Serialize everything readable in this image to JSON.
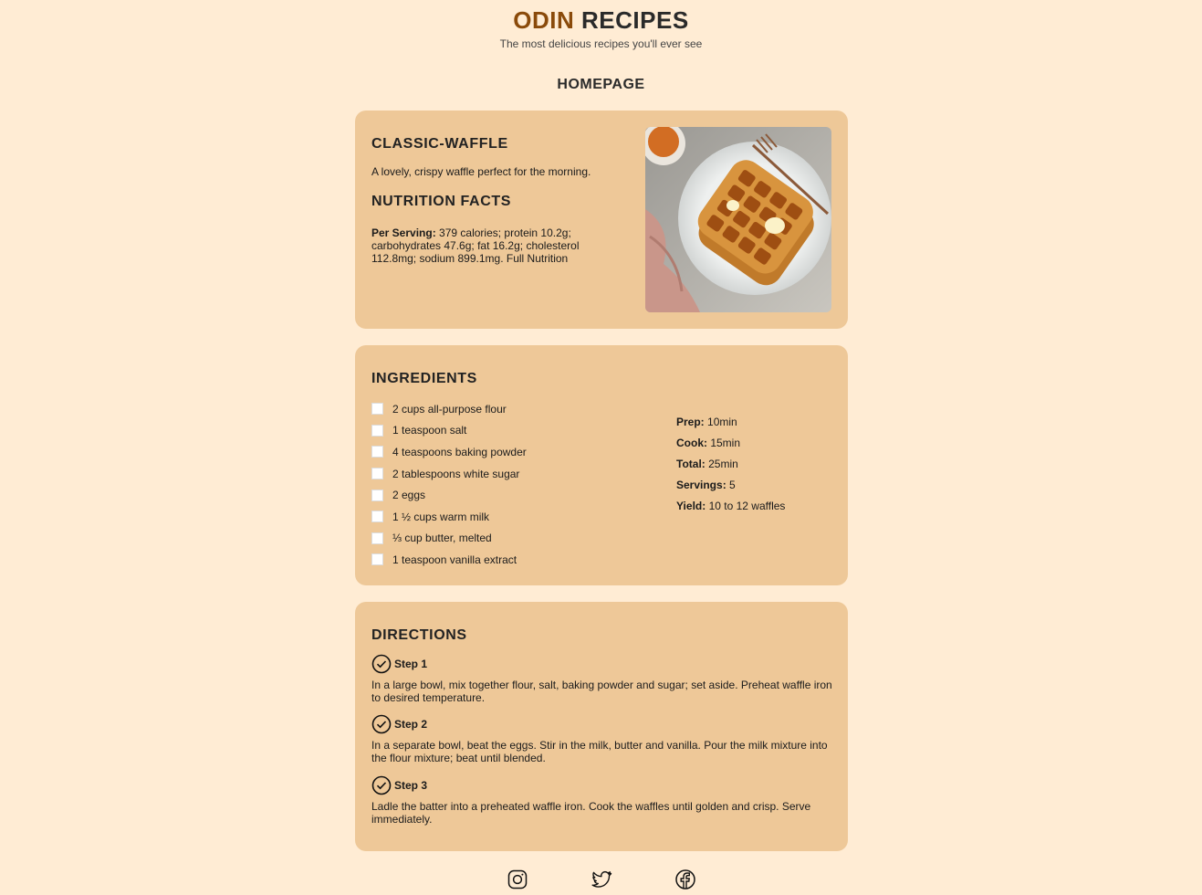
{
  "header": {
    "brand_accent": "ODIN",
    "brand_main": "RECIPES",
    "tagline": "The most delicious recipes you'll ever see"
  },
  "nav": {
    "homepage": "HOMEPAGE"
  },
  "recipe": {
    "title": "CLASSIC-WAFFLE",
    "description": "A lovely, crispy waffle perfect for the morning.",
    "nutrition_title": "NUTRITION FACTS",
    "nutrition_label": "Per Serving:",
    "nutrition_text": " 379 calories; protein 10.2g; carbohydrates 47.6g; fat 16.2g; cholesterol 112.8mg; sodium 899.1mg. Full Nutrition",
    "image_icon": "waffle-photo"
  },
  "ingredients": {
    "title": "INGREDIENTS",
    "items": [
      "2 cups all-purpose flour",
      "1 teaspoon salt",
      "4 teaspoons baking powder",
      "2 tablespoons white sugar",
      "2 eggs",
      "1 ½ cups warm milk",
      "⅓ cup butter, melted",
      "1 teaspoon vanilla extract"
    ]
  },
  "times": {
    "prep_label": "Prep:",
    "prep": " 10min",
    "cook_label": "Cook:",
    "cook": " 15min",
    "total_label": "Total:",
    "total": " 25min",
    "servings_label": "Servings:",
    "servings": " 5",
    "yield_label": "Yield:",
    "yield": " 10 to 12 waffles"
  },
  "directions": {
    "title": "DIRECTIONS",
    "steps": [
      {
        "label": "Step 1",
        "text": "In a large bowl, mix together flour, salt, baking powder and sugar; set aside. Preheat waffle iron to desired temperature."
      },
      {
        "label": "Step 2",
        "text": "In a separate bowl, beat the eggs. Stir in the milk, butter and vanilla. Pour the milk mixture into the flour mixture; beat until blended."
      },
      {
        "label": "Step 3",
        "text": "Ladle the batter into a preheated waffle iron. Cook the waffles until golden and crisp. Serve immediately."
      }
    ]
  },
  "footer": {
    "icons": [
      "instagram-icon",
      "twitter-icon",
      "facebook-icon"
    ]
  },
  "colors": {
    "background": "#ffecd4",
    "card": "#eec898",
    "brand_accent": "#8a4a0a"
  }
}
